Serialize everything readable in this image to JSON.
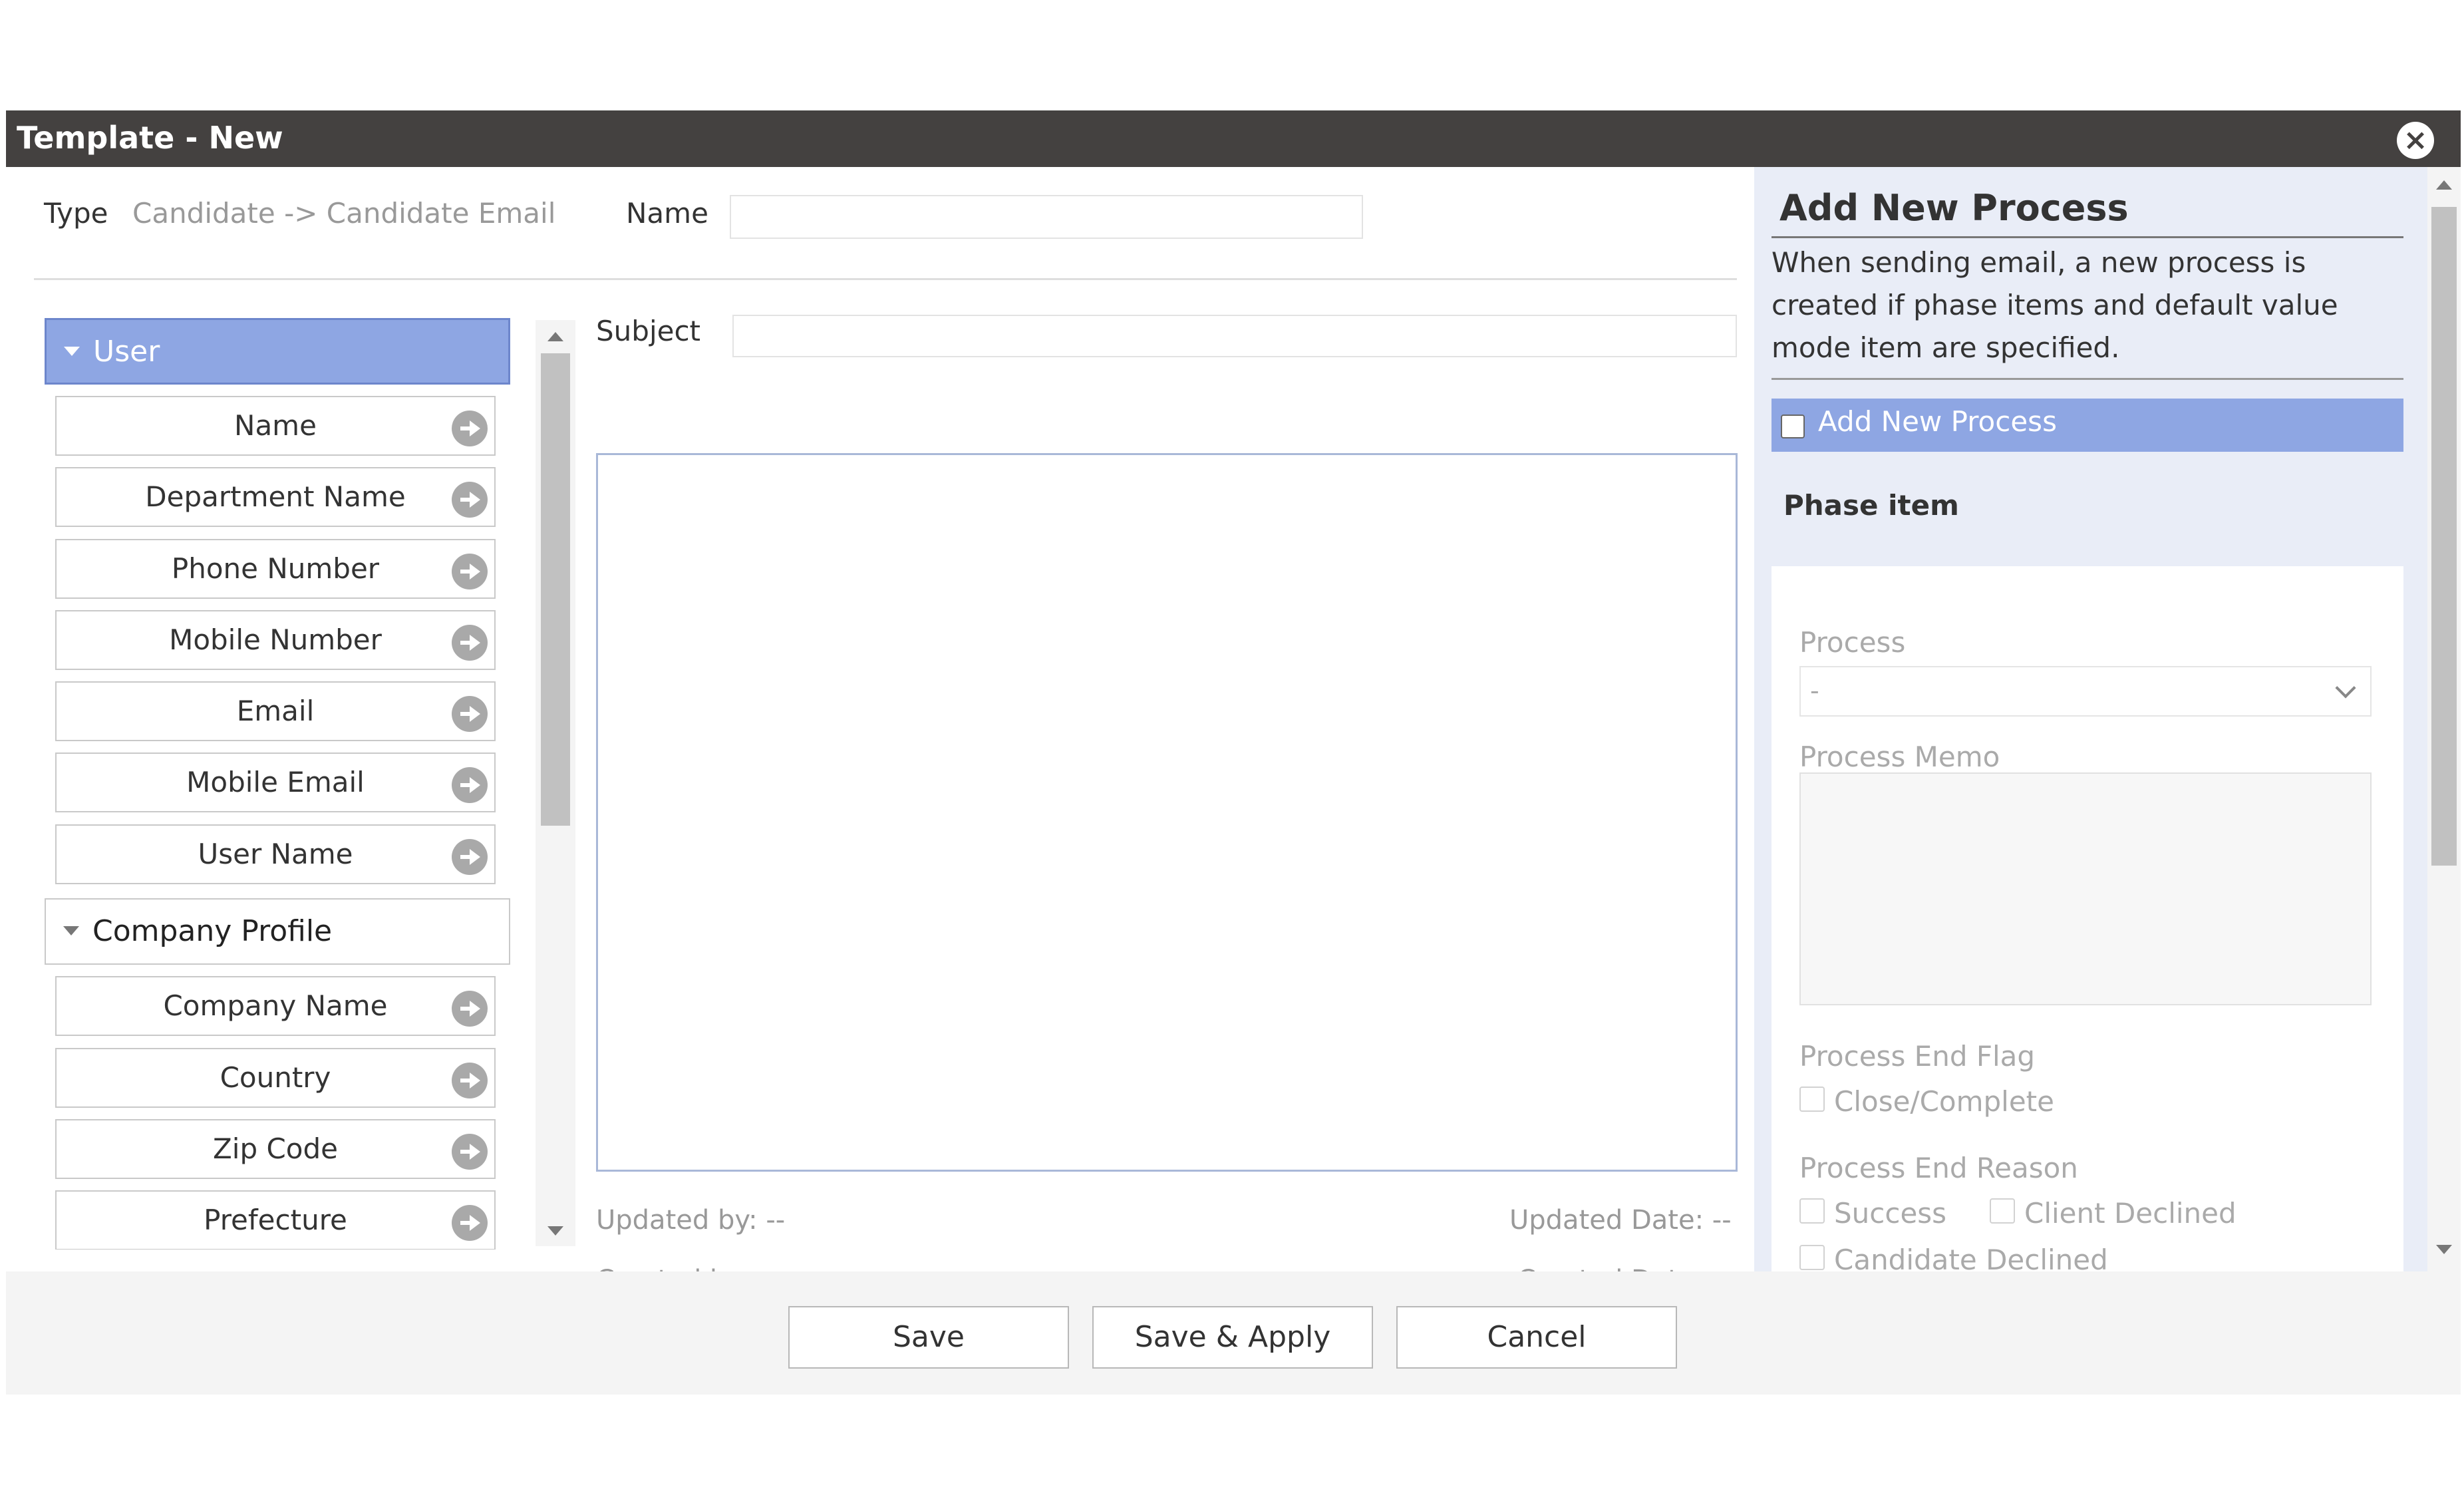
{
  "dialog": {
    "title": "Template - New"
  },
  "header": {
    "type_label": "Type",
    "type_value": "Candidate -> Candidate Email",
    "name_label": "Name",
    "name_value": ""
  },
  "fields": {
    "groups": [
      {
        "label": "User",
        "expanded": true,
        "items": [
          "Name",
          "Department Name",
          "Phone Number",
          "Mobile Number",
          "Email",
          "Mobile Email",
          "User Name"
        ]
      },
      {
        "label": "Company Profile",
        "expanded": true,
        "items": [
          "Company Name",
          "Country",
          "Zip Code",
          "Prefecture"
        ]
      }
    ]
  },
  "editor": {
    "subject_label": "Subject",
    "subject_value": "",
    "updated_by": "Updated by: --",
    "updated_date": "Updated Date: --",
    "created_by": "Created by: --",
    "created_date": "Created Date: --"
  },
  "side": {
    "title": "Add New Process",
    "description": "When sending email, a new process is created if phase items and default value mode item are specified.",
    "checkbox_label": "Add New Process",
    "phase_label": "Phase item",
    "process_label": "Process",
    "process_value": "-",
    "memo_label": "Process Memo",
    "end_flag_label": "Process End Flag",
    "close_complete": "Close/Complete",
    "end_reason_label": "Process End Reason",
    "success": "Success",
    "client_declined": "Client Declined",
    "candidate_declined": "Candidate Declined"
  },
  "footer": {
    "save": "Save",
    "save_apply": "Save & Apply",
    "cancel": "Cancel"
  },
  "colors": {
    "titlebar": "#444140",
    "accent": "#8ea6e3",
    "side_bg": "#e9edf7"
  }
}
